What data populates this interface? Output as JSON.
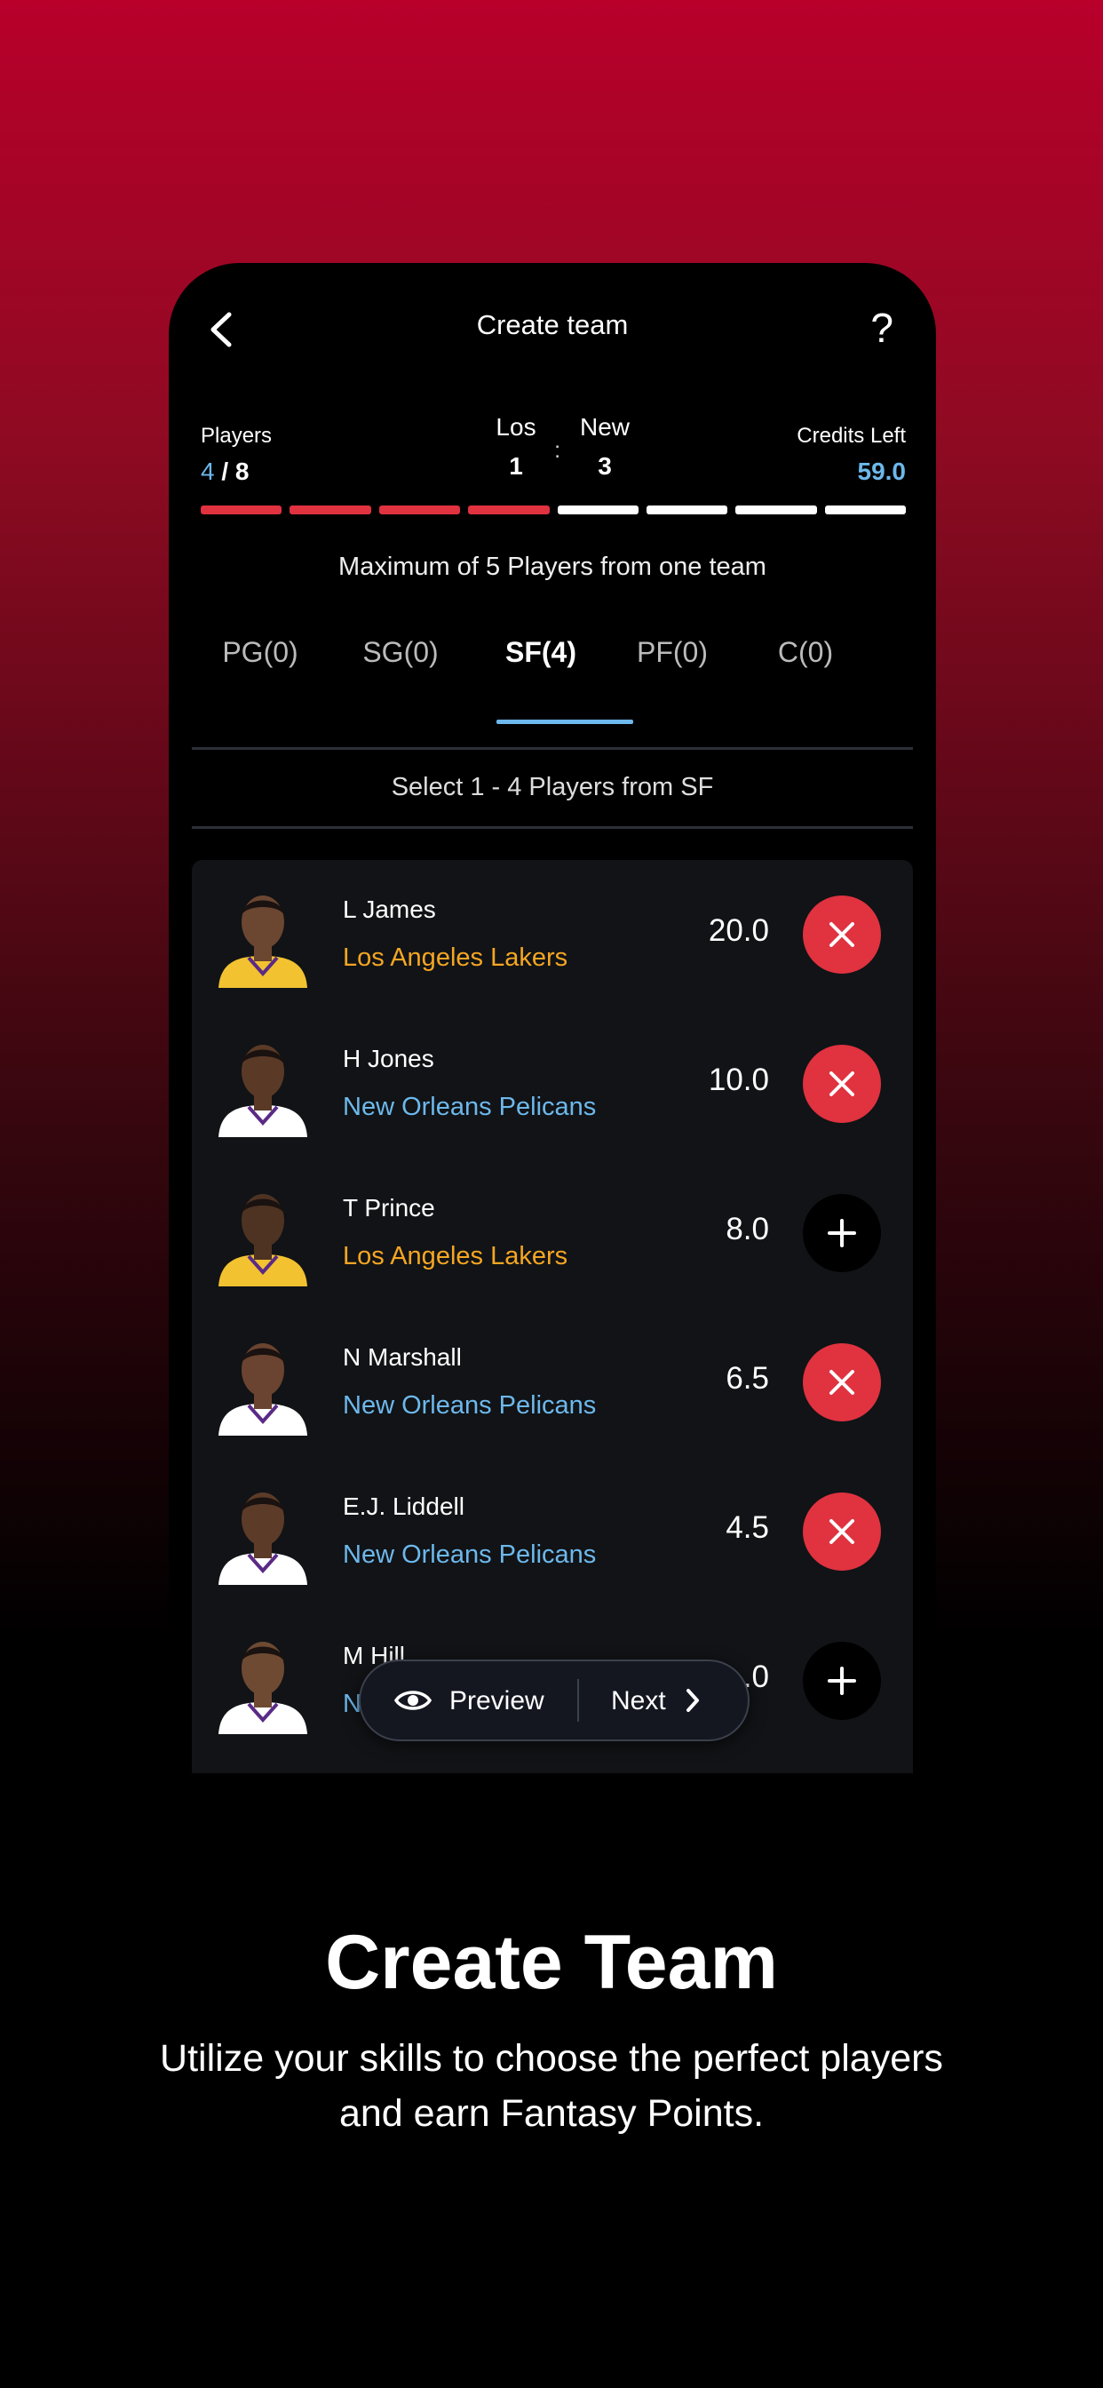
{
  "header": {
    "title": "Create team"
  },
  "stats": {
    "players_label": "Players",
    "players_selected": "4",
    "players_total": " / 8",
    "team1_name": "Los",
    "team1_count": "1",
    "team2_name": "New",
    "team2_count": "3",
    "colon": ":",
    "credits_label": "Credits Left",
    "credits_value": "59.0",
    "progress_filled": 4,
    "progress_total": 8
  },
  "notes": {
    "max_players": "Maximum of 5 Players from one team",
    "select_range": "Select 1 - 4 Players from SF"
  },
  "tabs": [
    {
      "label": "PG(0)",
      "active": false
    },
    {
      "label": "SG(0)",
      "active": false
    },
    {
      "label": "SF(4)",
      "active": true
    },
    {
      "label": "PF(0)",
      "active": false
    },
    {
      "label": "C(0)",
      "active": false
    }
  ],
  "players": [
    {
      "name": "L James",
      "team": "Los Angeles Lakers",
      "credits": "20.0",
      "selected": true
    },
    {
      "name": "H Jones",
      "team": "New Orleans Pelicans",
      "credits": "10.0",
      "selected": true
    },
    {
      "name": "T Prince",
      "team": "Los Angeles Lakers",
      "credits": "8.0",
      "selected": false
    },
    {
      "name": "N Marshall",
      "team": "New Orleans Pelicans",
      "credits": "6.5",
      "selected": true
    },
    {
      "name": "E.J. Liddell",
      "team": "New Orleans Pelicans",
      "credits": "4.5",
      "selected": true
    },
    {
      "name": "M Hill",
      "team": "N",
      "credits": ".0",
      "selected": false
    }
  ],
  "floater": {
    "preview_label": "Preview",
    "next_label": "Next"
  },
  "promo": {
    "title": "Create Team",
    "subtitle": "Utilize your skills to choose the perfect players and earn Fantasy Points."
  },
  "colors": {
    "accent_red": "#e0323f",
    "accent_blue": "#6db8ec",
    "lakers_gold": "#f5a623"
  }
}
